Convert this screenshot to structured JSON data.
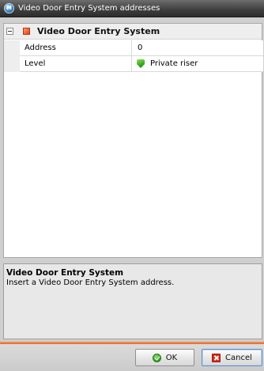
{
  "window": {
    "title": "Video Door Entry System addresses"
  },
  "property_grid": {
    "group_title": "Video Door Entry System",
    "rows": [
      {
        "name": "Address",
        "value": "0"
      },
      {
        "name": "Level",
        "value": "Private riser",
        "icon": "green-shield-icon"
      }
    ]
  },
  "description": {
    "title": "Video Door Entry System",
    "text": "Insert a Video Door Entry System address."
  },
  "buttons": {
    "ok": "OK",
    "cancel": "Cancel"
  },
  "colors": {
    "titlebar": "#3e3e3e",
    "footer_accent": "#e5662a",
    "group_icon": "#e3411b",
    "level_icon": "#2d9b1a"
  }
}
